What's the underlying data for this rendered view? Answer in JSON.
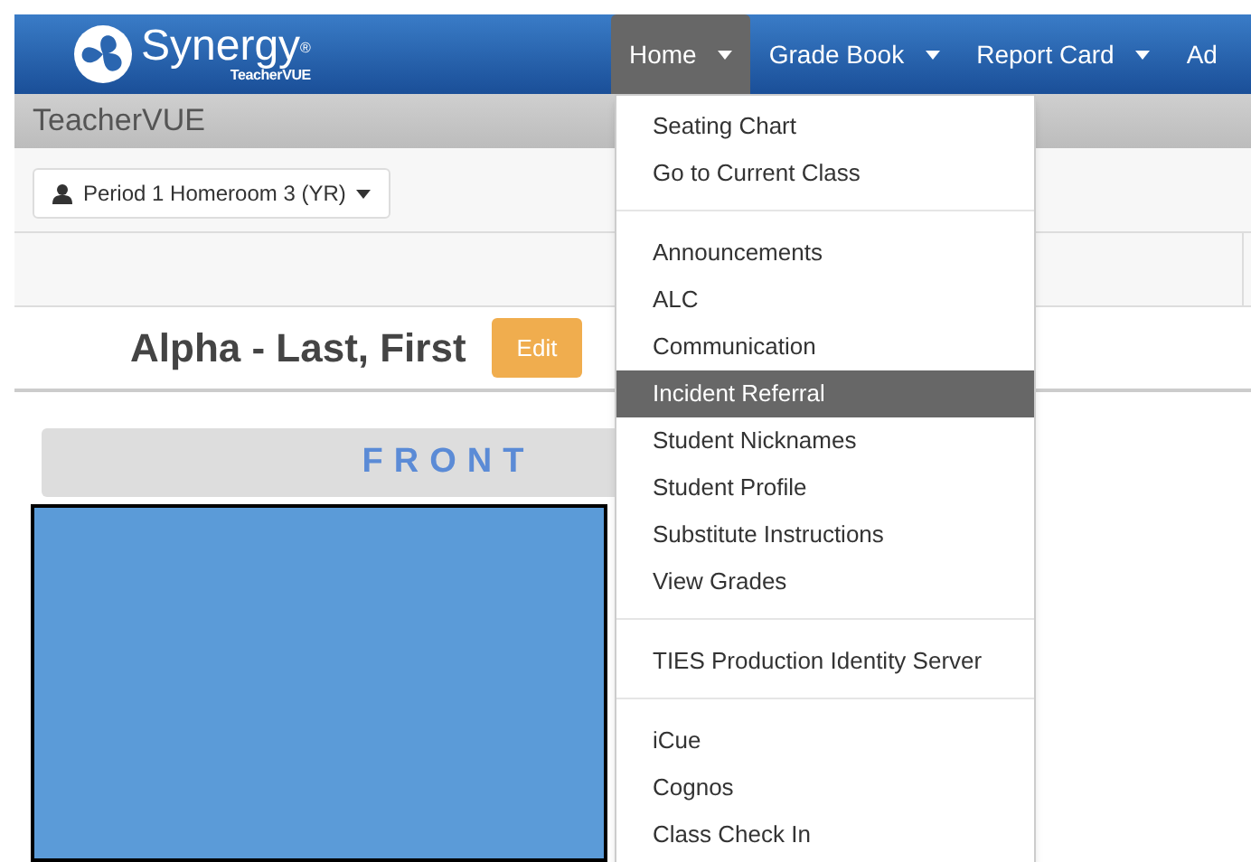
{
  "navbar": {
    "logo": {
      "name": "Synergy",
      "trademark": "®",
      "sub": "TeacherVUE"
    },
    "items": [
      {
        "label": "Home",
        "selected": true
      },
      {
        "label": "Grade Book",
        "selected": false
      },
      {
        "label": "Report Card",
        "selected": false
      },
      {
        "label": "Ad",
        "selected": false
      }
    ]
  },
  "subheader": {
    "title": "TeacherVUE"
  },
  "class_selector": {
    "value": "Period 1 Homeroom 3 (YR)"
  },
  "student": {
    "name": "Alpha - Last, First",
    "edit_button": "Edit"
  },
  "seating_chart": {
    "front_label": "FRONT"
  },
  "home_menu": {
    "groups": [
      {
        "items": [
          {
            "label": "Seating Chart",
            "selected": false
          },
          {
            "label": "Go to Current Class",
            "selected": false
          }
        ]
      },
      {
        "items": [
          {
            "label": "Announcements",
            "selected": false
          },
          {
            "label": "ALC",
            "selected": false
          },
          {
            "label": "Communication",
            "selected": false
          },
          {
            "label": "Incident Referral",
            "selected": true
          },
          {
            "label": "Student Nicknames",
            "selected": false
          },
          {
            "label": "Student Profile",
            "selected": false
          },
          {
            "label": "Substitute Instructions",
            "selected": false
          },
          {
            "label": "View Grades",
            "selected": false
          }
        ]
      },
      {
        "items": [
          {
            "label": "TIES Production Identity Server",
            "selected": false
          }
        ]
      },
      {
        "items": [
          {
            "label": "iCue",
            "selected": false
          },
          {
            "label": "Cognos",
            "selected": false
          },
          {
            "label": "Class Check In",
            "selected": false
          }
        ]
      }
    ]
  }
}
